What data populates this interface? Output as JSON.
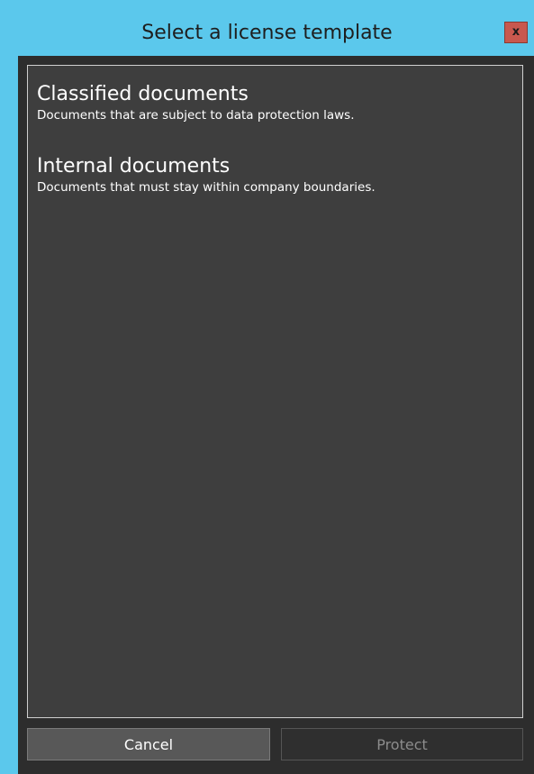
{
  "window": {
    "title": "Select a license template",
    "close_label": "x"
  },
  "templates": [
    {
      "name": "Classified documents",
      "description": "Documents that are subject to data protection laws."
    },
    {
      "name": "Internal documents",
      "description": "Documents that must stay within company boundaries."
    }
  ],
  "buttons": {
    "cancel_label": "Cancel",
    "protect_label": "Protect"
  },
  "colors": {
    "titlebar_accent": "#5bc8ec",
    "close_button": "#c8584e",
    "panel_background": "#3e3e3e"
  }
}
